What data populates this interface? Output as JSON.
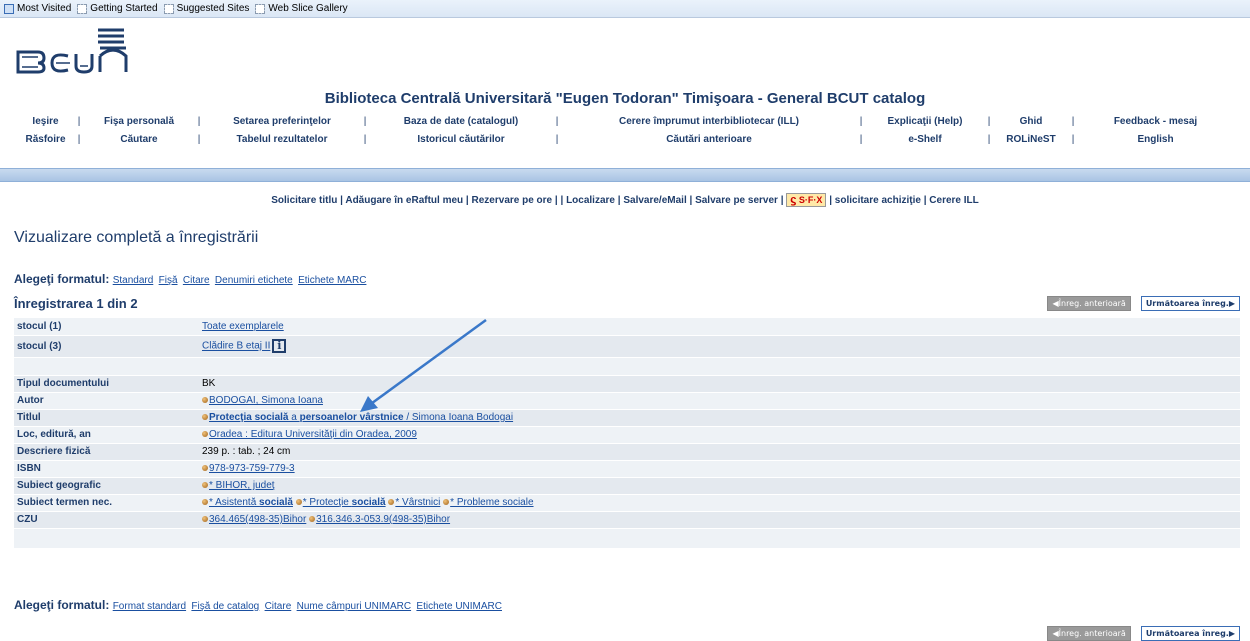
{
  "bookmarks": [
    "Most Visited",
    "Getting Started",
    "Suggested Sites",
    "Web Slice Gallery"
  ],
  "site_title": "Biblioteca Centrală Universitară \"Eugen Todoran\" Timişoara - General BCUT catalog",
  "nav_row1": [
    "Ieşire",
    "Fişa personală",
    "Setarea preferinţelor",
    "Baza de date (catalogul)",
    "Cerere împrumut interbibliotecar (ILL)",
    "Explicaţii (Help)",
    "Ghid",
    "Feedback - mesaj"
  ],
  "nav_row2": [
    "Răsfoire",
    "Căutare",
    "Tabelul rezultatelor",
    "Istoricul căutărilor",
    "Căutări anterioare",
    "e-Shelf",
    "ROLiNeST",
    "English"
  ],
  "actions": {
    "solicitare_titlu": "Solicitare titlu",
    "adaugare": "Adăugare în eRaftul meu",
    "rezervare": "Rezervare pe ore",
    "localizare": "Localizare",
    "salvare_email": "Salvare/eMail",
    "salvare_server": "Salvare pe server",
    "sfx": "S·F·X",
    "achizitie": "solicitare achiziţie",
    "cerere_ill": "Cerere ILL"
  },
  "page_title": "Vizualizare completă a înregistrării",
  "format_label": "Alegeţi formatul:",
  "formats_top": [
    "Standard",
    "Fişă",
    "Citare",
    "Denumiri etichete",
    "Etichete MARC"
  ],
  "formats_bottom": [
    "Format standard",
    "Fişă de catalog",
    "Citare",
    "Nume câmpuri UNIMARC",
    "Etichete UNIMARC"
  ],
  "record_no": "Înregistrarea 1 din 2",
  "prev_label": "Înreg. anterioară",
  "next_label": "Următoarea înreg.",
  "rows": {
    "stocul1_label": "stocul (1)",
    "stocul1_value": "Toate exemplarele",
    "stocul3_label": "stocul (3)",
    "stocul3_value": "Clădire B etaj II",
    "tip_label": "Tipul documentului",
    "tip_value": "BK",
    "autor_label": "Autor",
    "autor_value": "BODOGAI, Simona Ioana",
    "titlul_label": "Titlul",
    "titlul_part1": "Protecţia socială",
    "titlul_part2": " a ",
    "titlul_part3": "persoanelor vârstnice",
    "titlul_rest": " / Simona Ioana Bodogai",
    "loc_label": "Loc, editură, an",
    "loc_value": "Oradea : Editura Universităţii din Oradea, 2009",
    "descriere_label": "Descriere fizică",
    "descriere_value": "239 p. : tab. ; 24 cm",
    "isbn_label": "ISBN",
    "isbn_value": "978-973-759-779-3",
    "geo_label": "Subiect geografic",
    "geo_value": "* BIHOR, judeţ",
    "subiect_label": "Subiect termen nec.",
    "subiect1_a": "* Asistentă ",
    "subiect1_b": "socială",
    "subiect2_a": "* Protecţie ",
    "subiect2_b": "socială",
    "subiect3": "* Vârstnici",
    "subiect4": "* Probleme sociale",
    "czu_label": "CZU",
    "czu1": "364.465(498-35)Bihor",
    "czu2": "316.346.3-053.9(498-35)Bihor"
  },
  "info_icon": "i",
  "colors": {
    "brand": "#1f3d6b",
    "link": "#1a4fa0",
    "arrow": "#3a78c9"
  }
}
